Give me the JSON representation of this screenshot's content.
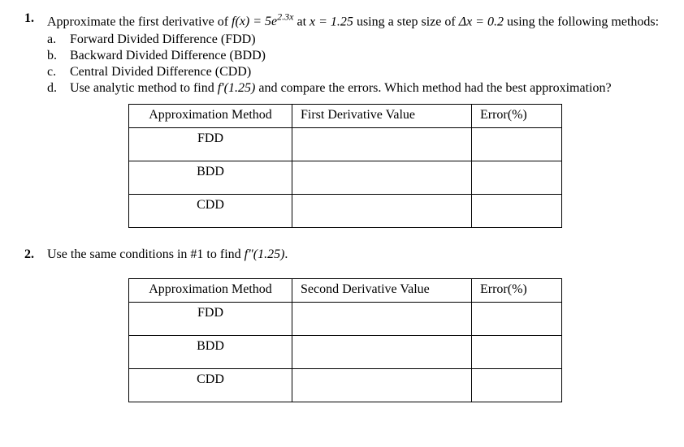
{
  "problem1": {
    "number": "1.",
    "intro_part1": "Approximate the first derivative of ",
    "formula": "f(x) = 5e",
    "exponent": "2.3x",
    "intro_part2": " at ",
    "xval": "x = 1.25",
    "intro_part3": "  using a step size of ",
    "delta": "Δx = 0.2",
    "intro_part4": " using the following methods:",
    "items": {
      "a": {
        "letter": "a.",
        "text": "Forward Divided Difference (FDD)"
      },
      "b": {
        "letter": "b.",
        "text": "Backward Divided Difference (BDD)"
      },
      "c": {
        "letter": "c.",
        "text": "Central Divided Difference (CDD)"
      },
      "d": {
        "letter": "d.",
        "text_part1": "Use analytic method to find ",
        "fprime": "f′(1.25)",
        "text_part2": " and compare the errors. Which method had the best approximation?"
      }
    },
    "table": {
      "headers": {
        "method": "Approximation Method",
        "value": "First Derivative Value",
        "error": "Error(%)"
      },
      "rows": {
        "r1": "FDD",
        "r2": "BDD",
        "r3": "CDD"
      }
    }
  },
  "problem2": {
    "number": "2.",
    "text_part1": "Use the same conditions in #1 to find ",
    "fdprime": "f″(1.25)",
    "text_part2": ".",
    "table": {
      "headers": {
        "method": "Approximation Method",
        "value": "Second  Derivative Value",
        "error": "Error(%)"
      },
      "rows": {
        "r1": "FDD",
        "r2": "BDD",
        "r3": "CDD"
      }
    }
  }
}
